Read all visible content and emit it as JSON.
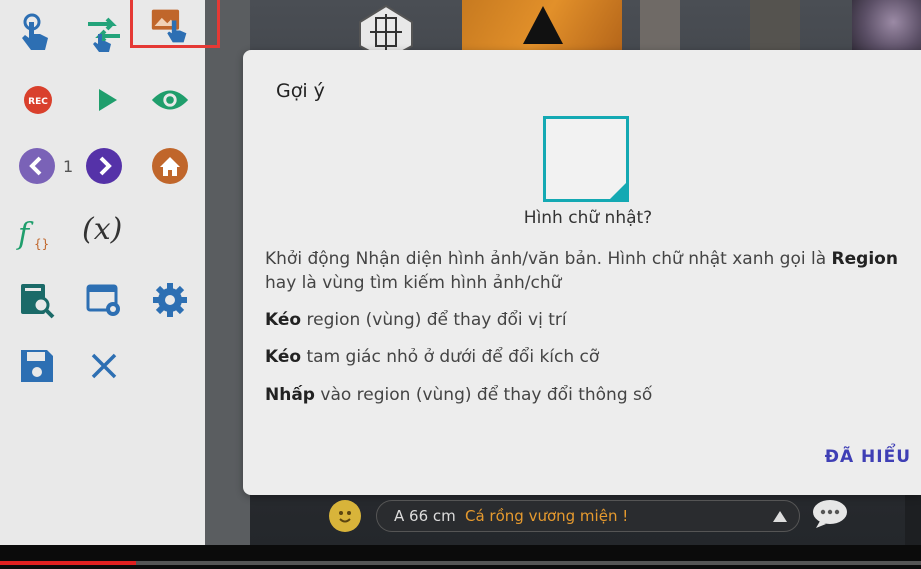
{
  "sidebar": {
    "page_number": "1",
    "fx_text": "(x)"
  },
  "dialog": {
    "title": "Gợi ý",
    "region_caption": "Hình chữ nhật?",
    "para1_pre": "Khởi động Nhận diện hình ảnh/văn bản. Hình chữ nhật xanh gọi là ",
    "para1_bold": "Region",
    "para1_post": " hay là vùng tìm kiếm hình ảnh/chữ",
    "para2_bold": "Kéo",
    "para2_rest": " region (vùng) để thay đổi vị trí",
    "para3_bold": "Kéo",
    "para3_rest": " tam giác nhỏ ở dưới để đổi kích cỡ",
    "para4_bold": "Nhấp",
    "para4_rest": " vào region (vùng) để thay đổi thông số",
    "ok_label": "ĐÃ HIỂU"
  },
  "chat": {
    "distance": "A 66 cm",
    "message": "Cá rồng vương miện !"
  },
  "video": {
    "progress_fraction": 0.148
  },
  "colors": {
    "accent_blue": "#2d6fb3",
    "accent_teal": "#14a9b3",
    "button_text": "#3f3fb5",
    "chat_orange": "#e69a2e"
  }
}
